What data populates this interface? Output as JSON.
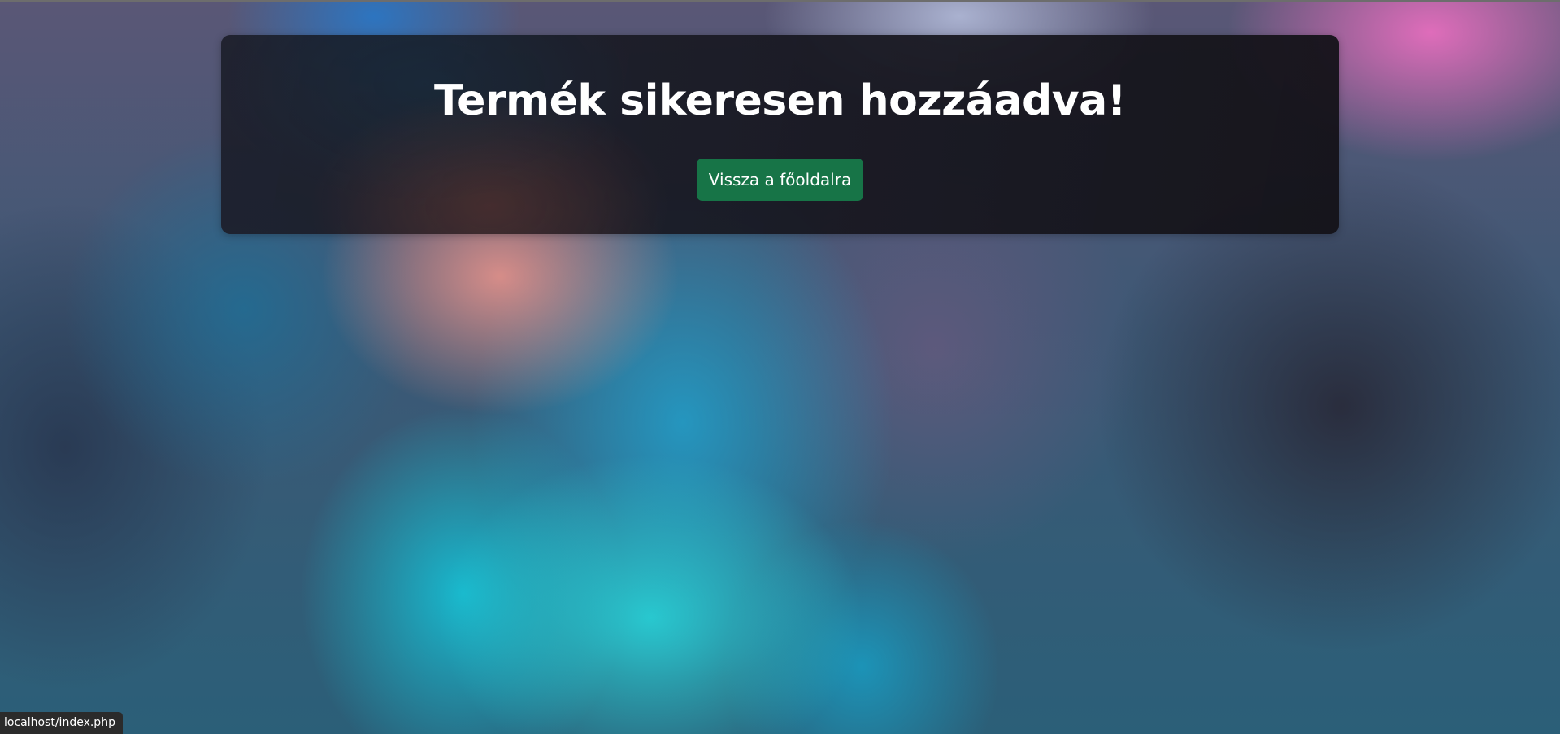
{
  "message": {
    "title": "Termék sikeresen hozzáadva!",
    "back_button_label": "Vissza a főoldalra"
  },
  "status_bar": {
    "url": "localhost/index.php"
  },
  "colors": {
    "button_background": "#177447",
    "card_background": "#1c1e2a",
    "text": "#ffffff"
  }
}
